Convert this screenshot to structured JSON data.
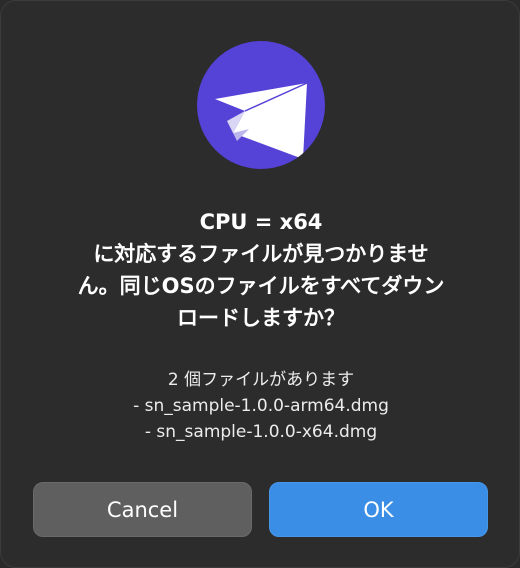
{
  "app_icon": "paper-plane-icon",
  "colors": {
    "icon_background": "#5542d6",
    "dialog_background": "#2c2c2c",
    "cancel_button": "#5f5f5f",
    "ok_button": "#3b8ee6"
  },
  "title_lines": [
    "CPU = x64",
    "に対応するファイルが見つかりませ",
    "ん。同じOSのファイルをすべてダウン",
    "ロードしますか？"
  ],
  "message_lines": [
    "2 個ファイルがあります",
    "- sn_sample-1.0.0-arm64.dmg",
    "- sn_sample-1.0.0-x64.dmg"
  ],
  "buttons": {
    "cancel_label": "Cancel",
    "ok_label": "OK"
  }
}
